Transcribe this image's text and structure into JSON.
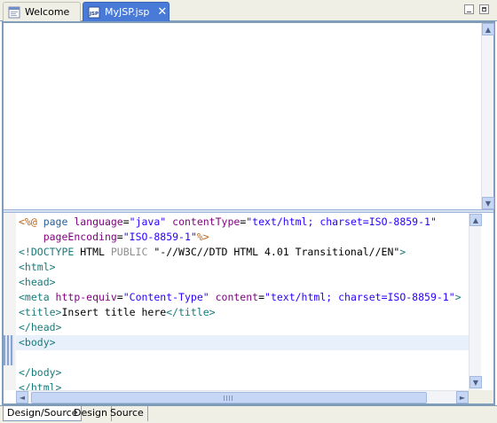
{
  "tabs": [
    {
      "label": "Welcome",
      "icon": "welcome-page-icon",
      "active": false
    },
    {
      "label": "MyJSP.jsp",
      "icon": "jsp-file-icon",
      "active": true
    }
  ],
  "colors": {
    "active_tab": "#4a7ad8",
    "frame_border": "#7f9db9",
    "current_line": "#e8f0fc"
  },
  "source_lines": [
    "<%@ page language=\"java\" contentType=\"text/html; charset=ISO-8859-1\"",
    "    pageEncoding=\"ISO-8859-1\"%>",
    "<!DOCTYPE HTML PUBLIC \"-//W3C//DTD HTML 4.01 Transitional//EN\">",
    "<html>",
    "<head>",
    "<meta http-equiv=\"Content-Type\" content=\"text/html; charset=ISO-8859-1\">",
    "<title>Insert title here</title>",
    "</head>",
    "<body>",
    "",
    "</body>",
    "</html>"
  ],
  "source_tokens": {
    "l0": [
      "<%@",
      " page ",
      "language",
      "=",
      "\"java\"",
      " ",
      "contentType",
      "=",
      "\"text/html; charset=ISO-8859-1\""
    ],
    "l1": [
      "    ",
      "pageEncoding",
      "=",
      "\"ISO-8859-1\"",
      "%>"
    ],
    "l2": [
      "<!DOCTYPE",
      " HTML ",
      "PUBLIC",
      " ",
      "\"-//W3C//DTD HTML 4.01 Transitional//EN\"",
      ">"
    ],
    "l3": [
      "<html>"
    ],
    "l4": [
      "<head>"
    ],
    "l5": [
      "<meta ",
      "http-equiv",
      "=",
      "\"Content-Type\"",
      " ",
      "content",
      "=",
      "\"text/html; charset=ISO-8859-1\"",
      ">"
    ],
    "l6": [
      "<title>",
      "Insert title here",
      "</title>"
    ],
    "l7": [
      "</head>"
    ],
    "l8": [
      "<body>"
    ],
    "l10": [
      "</body>"
    ],
    "l11": [
      "</html>"
    ]
  },
  "bottom_tabs": [
    {
      "label": "Design/Source",
      "active": true
    },
    {
      "label": "Design",
      "active": false
    },
    {
      "label": "Source",
      "active": false
    }
  ],
  "icons": {
    "up": "▲",
    "down": "▼",
    "left": "◄",
    "right": "►",
    "close": "✕"
  }
}
